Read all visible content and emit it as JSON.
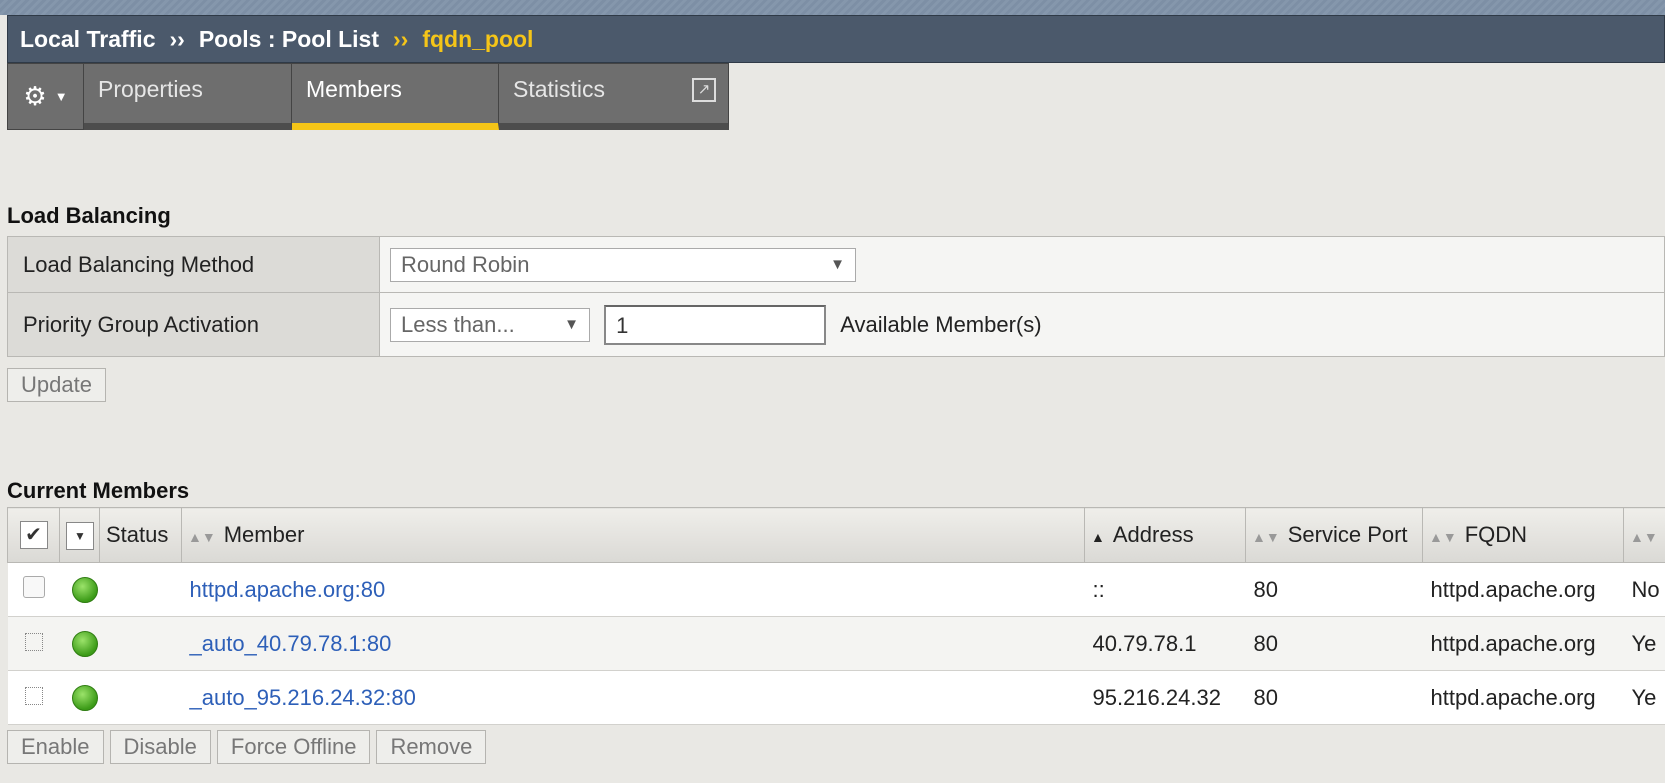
{
  "breadcrumb": {
    "items": [
      "Local Traffic",
      "Pools : Pool List"
    ],
    "separator": "››",
    "current": "fqdn_pool"
  },
  "tabs": [
    {
      "label": "Properties"
    },
    {
      "label": "Members",
      "active": true
    },
    {
      "label": "Statistics"
    }
  ],
  "icons": {
    "gear": "gear-icon",
    "caret": "chevron-down-icon",
    "external": "external-link-icon"
  },
  "load_balancing": {
    "section_title": "Load Balancing",
    "method_label": "Load Balancing Method",
    "method_value": "Round Robin",
    "priority_label": "Priority Group Activation",
    "priority_value": "Less than...",
    "priority_count": "1",
    "available_label": "Available Member(s)",
    "update_button": "Update"
  },
  "current_members": {
    "section_title": "Current Members",
    "columns": [
      "Status",
      "Member",
      "Address",
      "Service Port",
      "FQDN"
    ],
    "rows": [
      {
        "member": "httpd.apache.org:80",
        "address": "::",
        "port": "80",
        "fqdn": "httpd.apache.org",
        "extra": "No"
      },
      {
        "member": "_auto_40.79.78.1:80",
        "address": "40.79.78.1",
        "port": "80",
        "fqdn": "httpd.apache.org",
        "extra": "Ye"
      },
      {
        "member": "_auto_95.216.24.32:80",
        "address": "95.216.24.32",
        "port": "80",
        "fqdn": "httpd.apache.org",
        "extra": "Ye"
      }
    ],
    "buttons": {
      "enable": "Enable",
      "disable": "Disable",
      "force_offline": "Force Offline",
      "remove": "Remove"
    }
  },
  "colors": {
    "accent": "#f5c518",
    "link": "#2d5fb8",
    "status_available": "#3c9b18"
  }
}
